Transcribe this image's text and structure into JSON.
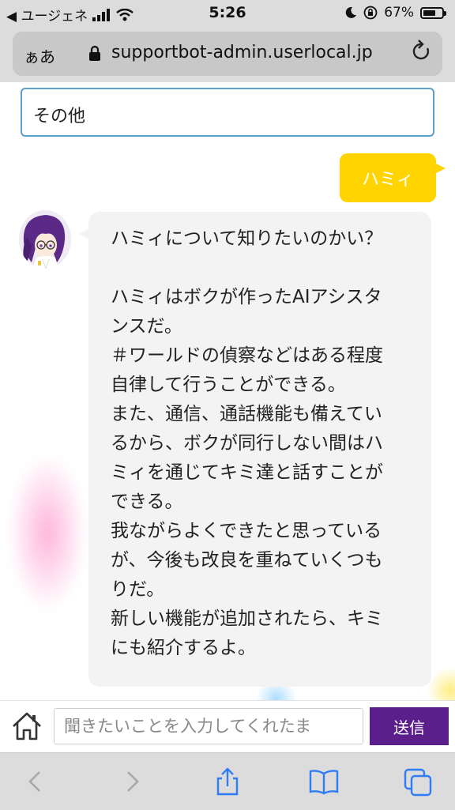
{
  "status_bar": {
    "back_app": "◀ ユージェネ",
    "time": "5:26",
    "battery_percent": "67%",
    "battery_level": 0.67
  },
  "browser": {
    "aa_label": "ぁあ",
    "url": "supportbot-admin.userlocal.jp"
  },
  "chat": {
    "previous_option": "その他",
    "user_message": "ハミィ",
    "bot_message_lines": [
      "ハミィについて知りたいのかい？",
      "",
      "ハミィはボクが作ったAIアシスタ",
      "ンスだ。",
      "＃ワールドの偵察などはある程度",
      "自律して行うことができる。",
      "また、通信、通話機能も備えてい",
      "るから、ボクが同行しない間はハ",
      "ミィを通じてキミ達と話すことが",
      "できる。",
      "我ながらよくできたと思っている",
      "が、今後も改良を重ねていくつも",
      "りだ。",
      "新しい機能が追加されたら、キミ",
      "にも紹介するよ。"
    ]
  },
  "input": {
    "placeholder": "聞きたいことを入力してくれたま",
    "send_label": "送信"
  },
  "colors": {
    "user_bubble": "#ffd400",
    "send_button": "#5a1f8a",
    "input_border": "#5aa0c8"
  }
}
